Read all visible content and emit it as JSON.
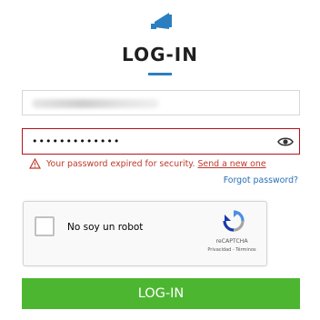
{
  "header": {
    "logo_icon": "horn-icon",
    "title": "LOG-IN"
  },
  "form": {
    "username": {
      "value": "",
      "blurred": true
    },
    "password": {
      "value": "•••••••••••••",
      "toggle_icon": "eye-icon"
    },
    "error": {
      "icon": "warning-triangle-icon",
      "text": "Your password expired for security.",
      "link": "Send a new one"
    },
    "forgot_password": "Forgot password?",
    "recaptcha": {
      "label": "No soy un robot",
      "brand": "reCAPTCHA",
      "terms": "Privacidad - Términos"
    },
    "submit": "LOG-IN"
  },
  "colors": {
    "accent_blue": "#2b7fc0",
    "error_red": "#c0392b",
    "error_border": "#b5121b",
    "link_blue": "#2a6fb6",
    "button_green": "#4db631"
  }
}
